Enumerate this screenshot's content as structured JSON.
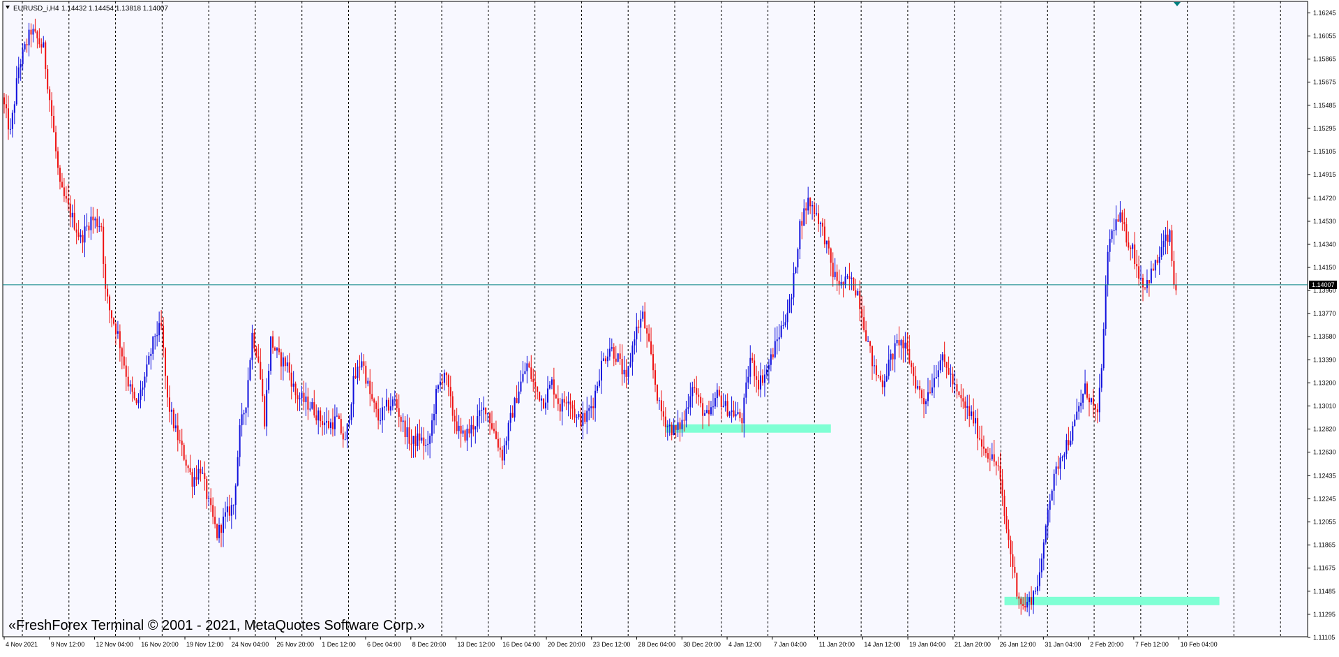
{
  "header": {
    "symbol_label": "EURUSD_i,H4",
    "ohlc_label": "1.14432 1.14454 1.13818 1.14007",
    "menu_arrow_icon": "triangle-down-icon",
    "shift_marker_icon": "triangle-down-icon"
  },
  "copyright": "«FreshForex Terminal © 2001 - 2021, MetaQuotes Software Corp.»",
  "colors": {
    "background": "#f8f8ff",
    "bull": "#1010dd",
    "bear": "#ee1111",
    "grid": "#000000",
    "level": "#008080",
    "zone": "#7fffd4"
  },
  "chart_data": {
    "type": "candlestick",
    "symbol": "EURUSD_i",
    "timeframe": "H4",
    "ylim": [
      1.1111,
      1.1634
    ],
    "y_ticks": [
      "1.16245",
      "1.16055",
      "1.15865",
      "1.15675",
      "1.15485",
      "1.15295",
      "1.15105",
      "1.14915",
      "1.14720",
      "1.14530",
      "1.14340",
      "1.14150",
      "1.13960",
      "1.13770",
      "1.13580",
      "1.13390",
      "1.13200",
      "1.13010",
      "1.12820",
      "1.12630",
      "1.12435",
      "1.12245",
      "1.12055",
      "1.11865",
      "1.11675",
      "1.11485",
      "1.11295",
      "1.11105"
    ],
    "x_ticks": [
      "4 Nov 2021",
      "9 Nov 12:00",
      "12 Nov 04:00",
      "16 Nov 20:00",
      "19 Nov 12:00",
      "24 Nov 04:00",
      "26 Nov 20:00",
      "1 Dec 12:00",
      "6 Dec 04:00",
      "8 Dec 20:00",
      "13 Dec 12:00",
      "16 Dec 04:00",
      "20 Dec 20:00",
      "23 Dec 12:00",
      "28 Dec 04:00",
      "30 Dec 20:00",
      "4 Jan 12:00",
      "7 Jan 04:00",
      "11 Jan 20:00",
      "14 Jan 12:00",
      "19 Jan 04:00",
      "21 Jan 20:00",
      "26 Jan 12:00",
      "31 Jan 04:00",
      "2 Feb 20:00",
      "7 Feb 12:00",
      "10 Feb 04:00"
    ],
    "current_price": "1.14007",
    "price_path": [
      [
        0,
        1.1555
      ],
      [
        4,
        1.1525
      ],
      [
        8,
        1.158
      ],
      [
        14,
        1.161
      ],
      [
        20,
        1.1595
      ],
      [
        24,
        1.154
      ],
      [
        28,
        1.148
      ],
      [
        33,
        1.146
      ],
      [
        38,
        1.1438
      ],
      [
        43,
        1.1455
      ],
      [
        48,
        1.145
      ],
      [
        50,
        1.1395
      ],
      [
        52,
        1.138
      ],
      [
        56,
        1.136
      ],
      [
        61,
        1.132
      ],
      [
        65,
        1.13
      ],
      [
        70,
        1.133
      ],
      [
        74,
        1.136
      ],
      [
        77,
        1.1365
      ],
      [
        80,
        1.1305
      ],
      [
        84,
        1.128
      ],
      [
        88,
        1.126
      ],
      [
        92,
        1.124
      ],
      [
        96,
        1.125
      ],
      [
        100,
        1.122
      ],
      [
        104,
        1.1195
      ],
      [
        108,
        1.121
      ],
      [
        112,
        1.122
      ],
      [
        115,
        1.128
      ],
      [
        118,
        1.1305
      ],
      [
        121,
        1.136
      ],
      [
        124,
        1.134
      ],
      [
        127,
        1.129
      ],
      [
        130,
        1.1355
      ],
      [
        134,
        1.134
      ],
      [
        138,
        1.1335
      ],
      [
        142,
        1.131
      ],
      [
        146,
        1.1305
      ],
      [
        150,
        1.13
      ],
      [
        154,
        1.129
      ],
      [
        158,
        1.1285
      ],
      [
        162,
        1.129
      ],
      [
        166,
        1.127
      ],
      [
        170,
        1.132
      ],
      [
        174,
        1.134
      ],
      [
        178,
        1.131
      ],
      [
        182,
        1.129
      ],
      [
        186,
        1.13
      ],
      [
        190,
        1.1305
      ],
      [
        194,
        1.1285
      ],
      [
        198,
        1.127
      ],
      [
        202,
        1.1275
      ],
      [
        206,
        1.1265
      ],
      [
        210,
        1.131
      ],
      [
        214,
        1.133
      ],
      [
        218,
        1.1295
      ],
      [
        222,
        1.1275
      ],
      [
        226,
        1.128
      ],
      [
        230,
        1.129
      ],
      [
        234,
        1.13
      ],
      [
        238,
        1.128
      ],
      [
        242,
        1.126
      ],
      [
        246,
        1.129
      ],
      [
        250,
        1.1315
      ],
      [
        254,
        1.1335
      ],
      [
        258,
        1.1315
      ],
      [
        262,
        1.1305
      ],
      [
        266,
        1.132
      ],
      [
        270,
        1.13
      ],
      [
        274,
        1.131
      ],
      [
        278,
        1.129
      ],
      [
        282,
        1.129
      ],
      [
        286,
        1.1305
      ],
      [
        290,
        1.1335
      ],
      [
        294,
        1.135
      ],
      [
        298,
        1.134
      ],
      [
        302,
        1.132
      ],
      [
        306,
        1.136
      ],
      [
        310,
        1.1375
      ],
      [
        314,
        1.134
      ],
      [
        318,
        1.13
      ],
      [
        322,
        1.1285
      ],
      [
        326,
        1.128
      ],
      [
        330,
        1.129
      ],
      [
        334,
        1.132
      ],
      [
        338,
        1.13
      ],
      [
        342,
        1.129
      ],
      [
        346,
        1.131
      ],
      [
        350,
        1.13
      ],
      [
        354,
        1.1295
      ],
      [
        358,
        1.129
      ],
      [
        362,
        1.134
      ],
      [
        366,
        1.132
      ],
      [
        370,
        1.133
      ],
      [
        374,
        1.135
      ],
      [
        378,
        1.137
      ],
      [
        382,
        1.139
      ],
      [
        386,
        1.145
      ],
      [
        390,
        1.147
      ],
      [
        394,
        1.146
      ],
      [
        398,
        1.144
      ],
      [
        402,
        1.141
      ],
      [
        406,
        1.14
      ],
      [
        410,
        1.1405
      ],
      [
        414,
        1.1395
      ],
      [
        418,
        1.136
      ],
      [
        422,
        1.133
      ],
      [
        426,
        1.132
      ],
      [
        430,
        1.134
      ],
      [
        434,
        1.1355
      ],
      [
        438,
        1.1345
      ],
      [
        442,
        1.132
      ],
      [
        446,
        1.1305
      ],
      [
        450,
        1.132
      ],
      [
        454,
        1.134
      ],
      [
        458,
        1.133
      ],
      [
        462,
        1.131
      ],
      [
        466,
        1.13
      ],
      [
        470,
        1.129
      ],
      [
        474,
        1.127
      ],
      [
        478,
        1.126
      ],
      [
        482,
        1.125
      ],
      [
        485,
        1.121
      ],
      [
        488,
        1.118
      ],
      [
        491,
        1.115
      ],
      [
        494,
        1.1135
      ],
      [
        497,
        1.114
      ],
      [
        500,
        1.115
      ],
      [
        503,
        1.117
      ],
      [
        506,
        1.122
      ],
      [
        509,
        1.124
      ],
      [
        512,
        1.126
      ],
      [
        515,
        1.127
      ],
      [
        518,
        1.128
      ],
      [
        521,
        1.13
      ],
      [
        524,
        1.1315
      ],
      [
        527,
        1.1305
      ],
      [
        530,
        1.129
      ],
      [
        533,
        1.136
      ],
      [
        535,
        1.143
      ],
      [
        538,
        1.145
      ],
      [
        541,
        1.1455
      ],
      [
        544,
        1.144
      ],
      [
        547,
        1.143
      ],
      [
        550,
        1.141
      ],
      [
        553,
        1.14
      ],
      [
        556,
        1.141
      ],
      [
        559,
        1.142
      ],
      [
        562,
        1.1435
      ],
      [
        565,
        1.144
      ],
      [
        567,
        1.14007
      ]
    ],
    "horizontal_line": 1.14007,
    "zones": [
      {
        "from_bar": 320,
        "to_bar": 400,
        "low": 1.1277,
        "high": 1.1283
      },
      {
        "from_bar": 484,
        "to_bar": 588,
        "low": 1.1132,
        "high": 1.1141
      }
    ]
  }
}
